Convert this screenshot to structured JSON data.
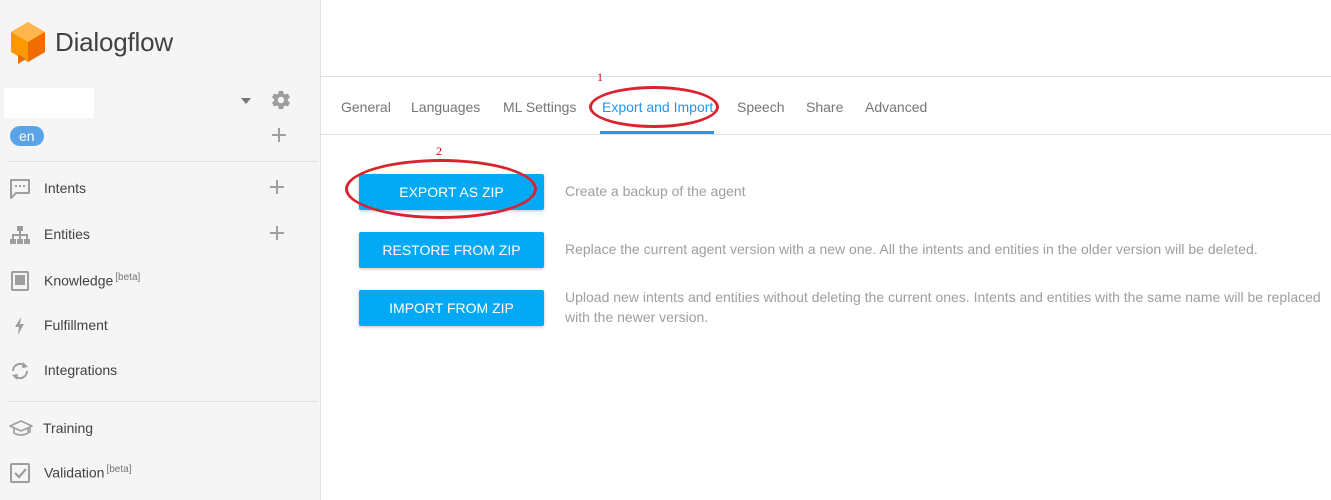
{
  "app": {
    "name": "Dialogflow"
  },
  "colors": {
    "accent": "#2196f3",
    "button": "#03a9f4",
    "language_pill": "#5aa3e6",
    "annotation": "#d9232e"
  },
  "sidebar": {
    "language": "en",
    "items": [
      {
        "label": "Intents",
        "icon": "chat-icon",
        "addable": true
      },
      {
        "label": "Entities",
        "icon": "hierarchy-icon",
        "addable": true
      },
      {
        "label": "Knowledge",
        "badge": "[beta]",
        "icon": "book-icon"
      },
      {
        "label": "Fulfillment",
        "icon": "bolt-icon"
      },
      {
        "label": "Integrations",
        "icon": "sync-icon"
      },
      {
        "label": "Training",
        "icon": "graduation-cap-icon"
      },
      {
        "label": "Validation",
        "badge": "[beta]",
        "icon": "checkbox-icon"
      }
    ]
  },
  "settings": {
    "tabs": [
      "General",
      "Languages",
      "ML Settings",
      "Export and Import",
      "Speech",
      "Share",
      "Advanced"
    ],
    "active_tab": "Export and Import",
    "actions": [
      {
        "label": "EXPORT AS ZIP",
        "description": "Create a backup of the agent"
      },
      {
        "label": "RESTORE FROM ZIP",
        "description": "Replace the current agent version with a new one. All the intents and entities in the older version will be deleted."
      },
      {
        "label": "IMPORT FROM ZIP",
        "description": "Upload new intents and entities without deleting the current ones. Intents and entities with the same name will be replaced with the newer version."
      }
    ]
  },
  "annotations": {
    "first": "1",
    "second": "2"
  }
}
